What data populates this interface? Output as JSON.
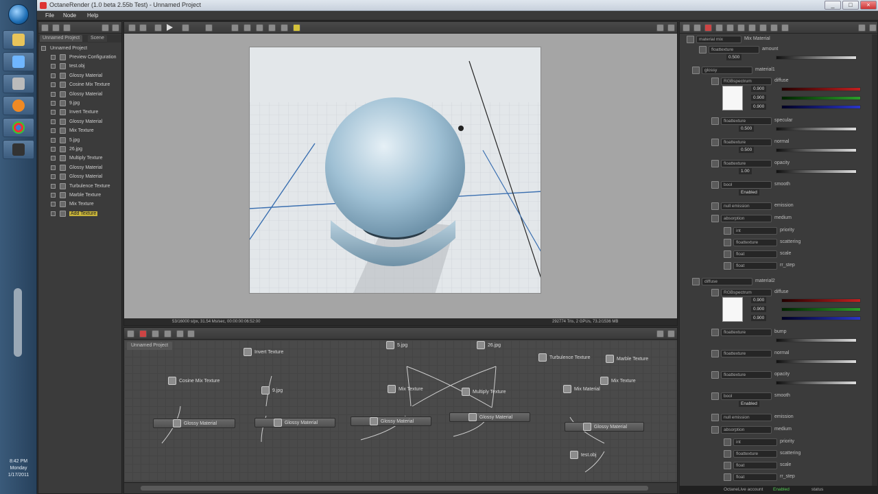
{
  "window": {
    "title": "OctaneRender (1.0 beta 2.55b Test) - Unnamed Project"
  },
  "menu": [
    "File",
    "Node",
    "Help"
  ],
  "taskbar": {
    "time": "8:42 PM",
    "day": "Monday",
    "date": "1/17/2011"
  },
  "scene": {
    "tabs": [
      "Unnamed Project",
      "Scene"
    ],
    "root": "Unnamed Project",
    "items": [
      {
        "label": "Preview Configuration"
      },
      {
        "label": "test.obj"
      },
      {
        "label": "Glossy Material"
      },
      {
        "label": "Cosine Mix Texture"
      },
      {
        "label": "Glossy Material"
      },
      {
        "label": "9.jpg"
      },
      {
        "label": "Invert Texture"
      },
      {
        "label": "Glossy Material"
      },
      {
        "label": "Mix Texture"
      },
      {
        "label": "5.jpg"
      },
      {
        "label": "26.jpg"
      },
      {
        "label": "Multiply Texture"
      },
      {
        "label": "Glossy Material"
      },
      {
        "label": "Glossy Material"
      },
      {
        "label": "Turbulence Texture"
      },
      {
        "label": "Marble Texture"
      },
      {
        "label": "Mix Texture"
      },
      {
        "label": "Add Texture",
        "selected": true
      }
    ]
  },
  "viewport": {
    "status_left": "53/16000 s/px, 31.54 Ms/sec, 00:00:00:06:52:00",
    "status_right": "292774 Tris, 2 GPUs, 73.2/1536 MB"
  },
  "nodegraph": {
    "tab": "Unnamed Project",
    "nodes": [
      {
        "label": "Invert Texture",
        "style": "icon"
      },
      {
        "label": "5.jpg",
        "style": "icon"
      },
      {
        "label": "26.jpg",
        "style": "icon"
      },
      {
        "label": "Turbulence Texture",
        "style": "icon"
      },
      {
        "label": "Marble Texture",
        "style": "icon"
      },
      {
        "label": "Cosine Mix Texture",
        "style": "icon"
      },
      {
        "label": "9.jpg",
        "style": "icon"
      },
      {
        "label": "Mix Texture",
        "style": "icon"
      },
      {
        "label": "Multiply Texture",
        "style": "icon"
      },
      {
        "label": "Mix Material",
        "style": "icon"
      },
      {
        "label": "Mix Texture",
        "style": "icon"
      },
      {
        "label": "Glossy Material",
        "style": "bar"
      },
      {
        "label": "Glossy Material",
        "style": "bar"
      },
      {
        "label": "Glossy Material",
        "style": "bar"
      },
      {
        "label": "Glossy Material",
        "style": "bar"
      },
      {
        "label": "Glossy Material",
        "style": "bar"
      },
      {
        "label": "test.obj",
        "style": "icon"
      }
    ]
  },
  "inspector": {
    "header": {
      "type": "material mix",
      "name": "Mix Material"
    },
    "amount": {
      "type": "floattexture",
      "name": "amount",
      "value": "0.500"
    },
    "material1": {
      "type": "glossy",
      "name": "material1"
    },
    "diffuse1": {
      "type": "RGBspectrum",
      "name": "diffuse",
      "r": "0.900",
      "g": "0.900",
      "b": "0.900"
    },
    "rows1": [
      {
        "type": "floattexture",
        "name": "specular",
        "value": "0.500"
      },
      {
        "type": "floattexture",
        "name": "normal",
        "value": "0.500"
      },
      {
        "type": "floattexture",
        "name": "opacity",
        "value": "1.00"
      },
      {
        "type": "bool",
        "name": "smooth",
        "value": "Enabled"
      },
      {
        "type": "null emission",
        "name": "emission"
      },
      {
        "type": "absorption",
        "name": "medium"
      }
    ],
    "medium1": [
      {
        "type": "int",
        "name": "priority"
      },
      {
        "type": "floattexture",
        "name": "scattering"
      },
      {
        "type": "float",
        "name": "scale"
      },
      {
        "type": "float",
        "name": "rr_step"
      }
    ],
    "material2": {
      "type": "diffuse",
      "name": "material2"
    },
    "diffuse2": {
      "type": "RGBspectrum",
      "name": "diffuse",
      "r": "0.900",
      "g": "0.900",
      "b": "0.900"
    },
    "rows2": [
      {
        "type": "floattexture",
        "name": "bump"
      },
      {
        "type": "floattexture",
        "name": "normal"
      },
      {
        "type": "floattexture",
        "name": "opacity"
      },
      {
        "type": "bool",
        "name": "smooth",
        "value": "Enabled"
      },
      {
        "type": "null emission",
        "name": "emission"
      },
      {
        "type": "absorption",
        "name": "medium"
      }
    ],
    "medium2": [
      {
        "type": "int",
        "name": "priority"
      },
      {
        "type": "floattexture",
        "name": "scattering"
      },
      {
        "type": "float",
        "name": "scale"
      },
      {
        "type": "float",
        "name": "rr_step"
      }
    ],
    "footer": {
      "left": "OctaneLive account",
      "mid": "Enabled",
      "right": "status"
    }
  },
  "colors": {
    "panel": "#3b3b3b",
    "highlight": "#c8b43a",
    "render_bg": "#dfe3e6",
    "sphere": "#9fc0d4"
  }
}
